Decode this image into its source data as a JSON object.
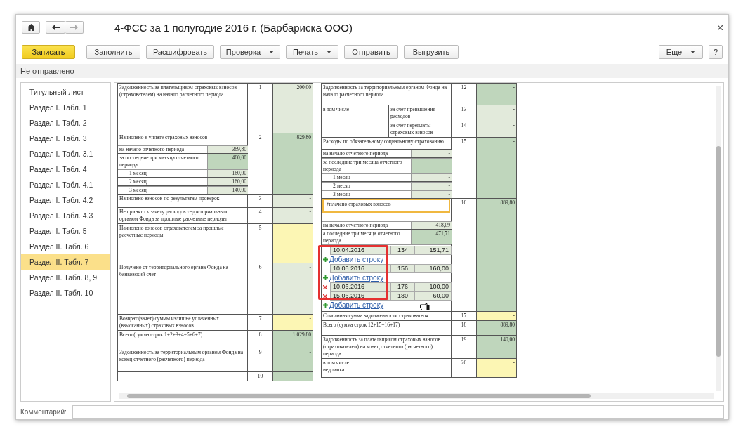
{
  "window": {
    "title": "4-ФСС за 1 полугодие 2016 г. (Барбариска ООО)"
  },
  "toolbar": {
    "buttons": [
      {
        "label": "Записать",
        "kind": "primary"
      },
      {
        "label": "Заполнить",
        "kind": "plain"
      },
      {
        "label": "Расшифровать",
        "kind": "plain"
      },
      {
        "label": "Проверка",
        "kind": "menu"
      },
      {
        "label": "Печать",
        "kind": "menu"
      },
      {
        "label": "Отправить",
        "kind": "plain"
      },
      {
        "label": "Выгрузить",
        "kind": "plain"
      }
    ],
    "right_buttons": [
      {
        "label": "Еще",
        "kind": "menu"
      },
      {
        "label": "?",
        "kind": "plain"
      }
    ]
  },
  "status": "Не отправлено",
  "sidebar": {
    "items": [
      {
        "label": "Титульный лист",
        "selected": false
      },
      {
        "label": "Раздел I. Табл. 1",
        "selected": false
      },
      {
        "label": "Раздел I. Табл. 2",
        "selected": false
      },
      {
        "label": "Раздел I. Табл. 3",
        "selected": false
      },
      {
        "label": "Раздел I. Табл. 3.1",
        "selected": false
      },
      {
        "label": "Раздел I. Табл. 4",
        "selected": false
      },
      {
        "label": "Раздел I. Табл. 4.1",
        "selected": false
      },
      {
        "label": "Раздел I. Табл. 4.2",
        "selected": false
      },
      {
        "label": "Раздел I. Табл. 4.3",
        "selected": false
      },
      {
        "label": "Раздел I. Табл. 5",
        "selected": false
      },
      {
        "label": "Раздел II. Табл. 6",
        "selected": false
      },
      {
        "label": "Раздел II. Табл. 7",
        "selected": true
      },
      {
        "label": "Раздел II. Табл. 8, 9",
        "selected": false
      },
      {
        "label": "Раздел II. Табл. 10",
        "selected": false
      }
    ]
  },
  "report": {
    "left": {
      "rows": [
        {
          "label": "Задолженность за плательщиком страховых взносов (страхователем) на начало расчетного периода",
          "code": "1",
          "value": "200,00",
          "kind": "calc"
        },
        {
          "label": "Начислено к уплате страховых взносов",
          "code": "2",
          "value": "829,80",
          "kind": "total",
          "subrows": [
            {
              "label": "на начало отчетного периода",
              "value": "369,80",
              "kind": "calc"
            },
            {
              "label": "за последние три месяца отчетного периода",
              "value": "460,00",
              "kind": "total",
              "children": [
                {
                  "label": "1 месяц",
                  "value": "160,00",
                  "kind": "calc"
                },
                {
                  "label": "2 месяц",
                  "value": "160,00",
                  "kind": "calc"
                },
                {
                  "label": "3 месяц",
                  "value": "140,00",
                  "kind": "calc"
                }
              ]
            }
          ]
        },
        {
          "label": "Начислено взносов по результатам проверок",
          "code": "3",
          "value": "-",
          "kind": "calc"
        },
        {
          "label": "Не принято к зачету расходов территориальным органом Фонда за прошлые расчетные периоды",
          "code": "4",
          "value": "-",
          "kind": "calc"
        },
        {
          "label": "Начислено взносов  страхователем за прошлые расчетные периоды",
          "code": "5",
          "value": "-",
          "kind": "input"
        },
        {
          "label": "Получено от территориального органа Фонда на банковский счет",
          "code": "6",
          "value": "-",
          "kind": "calc"
        },
        {
          "label": "Возврат (зачет) суммы излишне уплаченных (взысканных) страховых взносов",
          "code": "7",
          "value": "-",
          "kind": "input"
        },
        {
          "label": "Всего  (сумма строк 1+2+3+4+5+6+7)",
          "code": "8",
          "value": "1 029,80",
          "kind": "total"
        },
        {
          "label": "Задолженность за территориальным органом Фонда на конец отчетного (расчетного) периода",
          "code": "9",
          "value": "-",
          "kind": "total"
        },
        {
          "code": "10",
          "kind": "total"
        }
      ]
    },
    "right": {
      "rows": [
        {
          "label": "Задолженность за территориальным органом Фонда на начало расчетного периода",
          "code": "12",
          "value": "-",
          "kind": "total"
        },
        {
          "label": "в том числе",
          "parts": [
            {
              "label": "за счет превышения расходов",
              "code": "13",
              "value": "-",
              "kind": "calc"
            },
            {
              "label": "за счет переплаты страховых взносов",
              "code": "14",
              "value": "-",
              "kind": "calc"
            }
          ]
        },
        {
          "label": "Расходы по обязательному социальному страхованию",
          "code": "15",
          "value": "-",
          "kind": "total",
          "subrows": [
            {
              "label": "на начало отчетного периода",
              "value": "-",
              "kind": "calc"
            },
            {
              "label": "за последние три месяца отчетного периода",
              "value": "-",
              "kind": "total",
              "children": [
                {
                  "label": "1 месяц",
                  "value": "-",
                  "kind": "calc"
                },
                {
                  "label": "2 месяц",
                  "value": "-",
                  "kind": "calc"
                },
                {
                  "label": "3 месяц",
                  "value": "-",
                  "kind": "calc"
                }
              ]
            }
          ]
        },
        {
          "label": "Уплачено страховых взносов",
          "boxed": true,
          "code": "16",
          "value": "889,80",
          "kind": "total",
          "subrows": [
            {
              "label": "на начало отчетного периода",
              "value": "418,09",
              "kind": "calc"
            },
            {
              "label": "а последние три месяца отчетного периода",
              "value": "471,71",
              "kind": "total"
            }
          ],
          "payments": {
            "boxed": true,
            "items": [
              {
                "kind": "payment",
                "date": "10.04.2016",
                "number": "134",
                "amount": "151,71",
                "removable": false
              },
              {
                "kind": "add",
                "label": "Добавить строку"
              },
              {
                "kind": "payment",
                "date": "10.05.2016",
                "number": "156",
                "amount": "160,00",
                "removable": false
              },
              {
                "kind": "add",
                "label": "Добавить строку"
              },
              {
                "kind": "payment",
                "date": "10.06.2016",
                "number": "176",
                "amount": "100,00",
                "removable": true
              },
              {
                "kind": "payment",
                "date": "15.06.2016",
                "number": "180",
                "amount": "60,00",
                "removable": true
              },
              {
                "kind": "add",
                "label": "Добавить строку"
              }
            ]
          }
        },
        {
          "label": "Списанная сумма задолженности страхователя",
          "code": "17",
          "value": "-",
          "kind": "input"
        },
        {
          "label": "Всего (сумма строк 12+15+16+17)",
          "code": "18",
          "value": "889,80",
          "kind": "total"
        },
        {
          "label": "Задолженность за плательщиком страховых взносов (страхователем) на конец отчетного (расчетного) периода",
          "code": "19",
          "value": "140,00",
          "kind": "total"
        },
        {
          "label": "в том числе:\nнедоимка",
          "code": "20",
          "value": "-",
          "kind": "input"
        }
      ]
    }
  },
  "comment": {
    "label": "Комментарий:"
  }
}
